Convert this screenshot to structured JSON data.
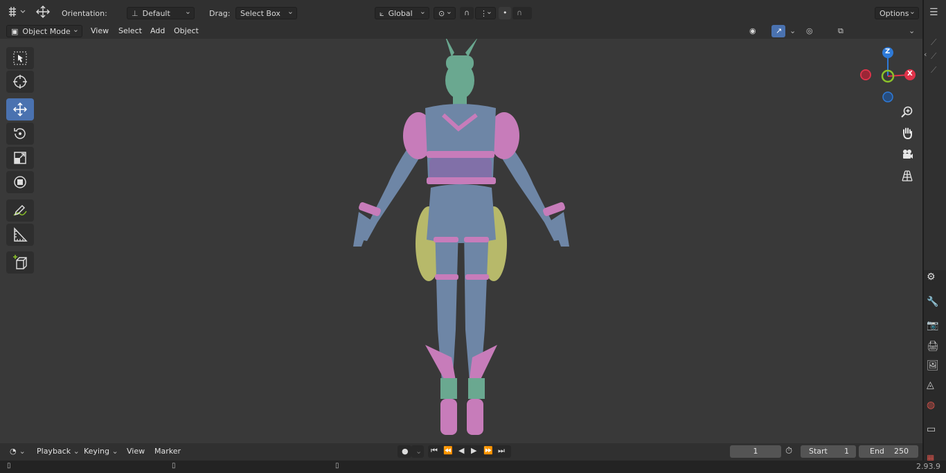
{
  "header": {
    "orientation_label": "Orientation:",
    "orientation_value": "Default",
    "drag_label": "Drag:",
    "drag_value": "Select Box",
    "transform_space": "Global",
    "options_label": "Options"
  },
  "viewport_header": {
    "mode": "Object Mode",
    "menus": [
      "View",
      "Select",
      "Add",
      "Object"
    ]
  },
  "toolbar": {
    "tools": [
      {
        "name": "select-box",
        "icon": "cursor-select-icon",
        "active": false
      },
      {
        "name": "cursor",
        "icon": "crosshair-cursor-icon",
        "active": false
      },
      {
        "name": "move",
        "icon": "move-arrows-icon",
        "active": true
      },
      {
        "name": "rotate",
        "icon": "rotate-icon",
        "active": false
      },
      {
        "name": "scale",
        "icon": "scale-icon",
        "active": false
      },
      {
        "name": "transform",
        "icon": "transform-icon",
        "active": false
      },
      {
        "name": "annotate",
        "icon": "pencil-annotate-icon",
        "active": false
      },
      {
        "name": "measure",
        "icon": "ruler-measure-icon",
        "active": false
      },
      {
        "name": "add-cube",
        "icon": "add-cube-icon",
        "active": false
      }
    ]
  },
  "gizmo": {
    "z": "Z",
    "y": "Y",
    "x": "X",
    "colors": {
      "x": "#e0334a",
      "y": "#8bc22a",
      "z": "#2e7ad8"
    }
  },
  "timeline": {
    "menus": [
      "Playback",
      "Keying",
      "View",
      "Marker"
    ],
    "current_frame": "1",
    "start_label": "Start",
    "start_value": "1",
    "end_label": "End",
    "end_value": "250"
  },
  "status": {
    "version": "2.93.9"
  },
  "colors": {
    "accent": "#4a72b0",
    "viewport_bg": "#393939",
    "model_skin": "#6e86a6",
    "model_pink": "#c77cba",
    "model_green": "#6aa890",
    "model_yellow": "#b7b96a"
  }
}
